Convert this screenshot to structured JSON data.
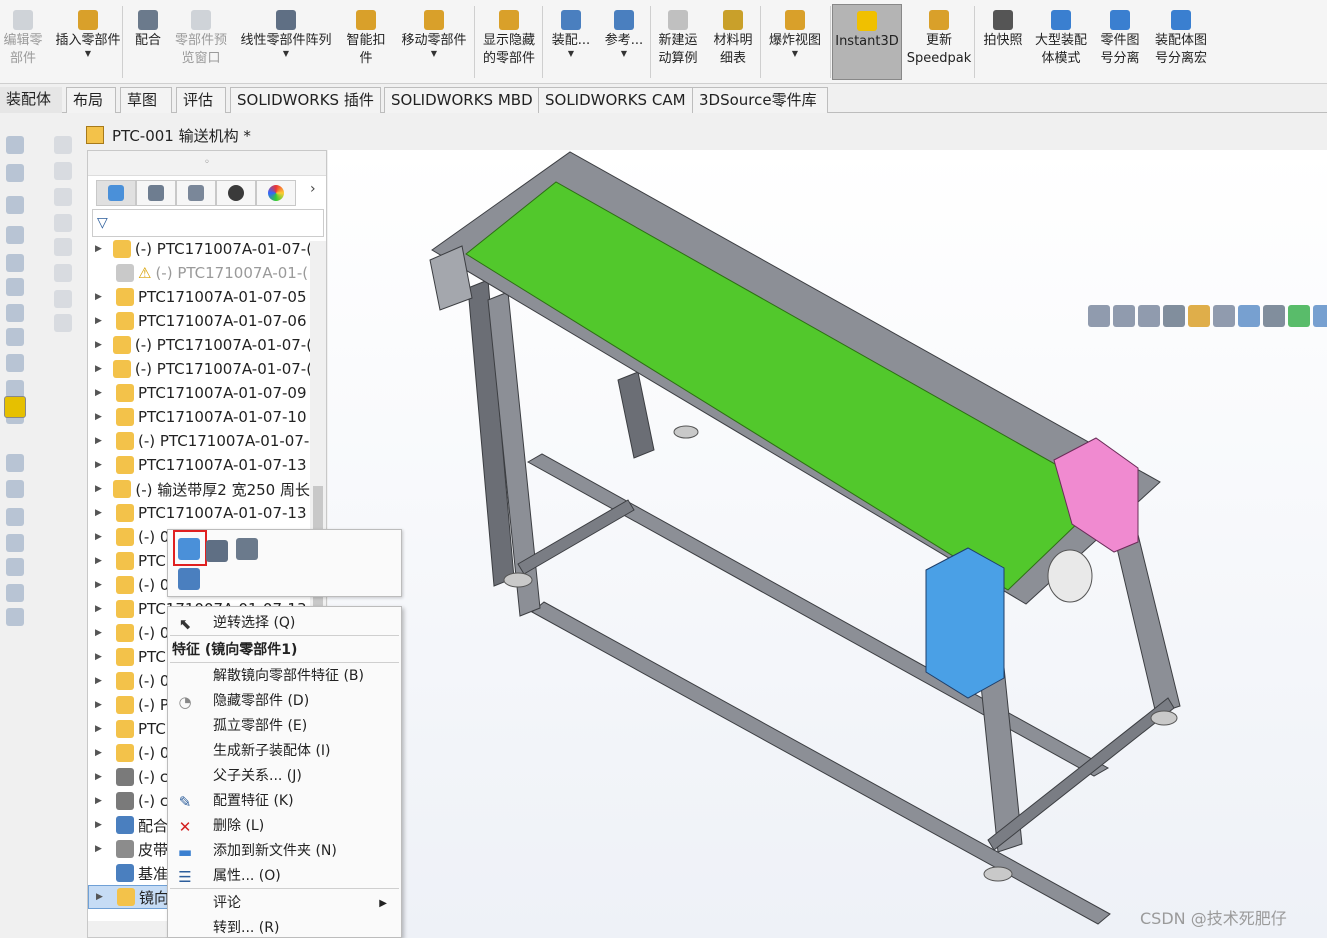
{
  "ribbon": [
    {
      "label": "编辑零\n部件",
      "disabled": true,
      "icon": "edit-component-icon"
    },
    {
      "label": "插入零部件",
      "disabled": false,
      "dropdown": true,
      "icon": "insert-component-icon"
    },
    {
      "label": "配合",
      "disabled": false,
      "icon": "mate-icon"
    },
    {
      "label": "零部件预\n览窗口",
      "disabled": true,
      "icon": "preview-window-icon"
    },
    {
      "label": "线性零部件阵列",
      "disabled": false,
      "dropdown": true,
      "icon": "linear-pattern-icon"
    },
    {
      "label": "智能扣\n件",
      "disabled": false,
      "icon": "smart-fastener-icon"
    },
    {
      "label": "移动零部件",
      "disabled": false,
      "dropdown": true,
      "icon": "move-component-icon"
    },
    {
      "label": "显示隐藏\n的零部件",
      "disabled": false,
      "icon": "show-hidden-icon"
    },
    {
      "label": "装配...",
      "disabled": false,
      "dropdown": true,
      "icon": "assembly-feature-icon"
    },
    {
      "label": "参考...",
      "disabled": false,
      "dropdown": true,
      "icon": "reference-geometry-icon"
    },
    {
      "label": "新建运\n动算例",
      "disabled": false,
      "icon": "motion-study-icon"
    },
    {
      "label": "材料明\n细表",
      "disabled": false,
      "icon": "bom-icon"
    },
    {
      "label": "爆炸视图",
      "disabled": false,
      "dropdown": true,
      "icon": "exploded-view-icon"
    },
    {
      "label": "Instant3D",
      "disabled": false,
      "active": true,
      "icon": "instant3d-icon"
    },
    {
      "label": "更新\nSpeedpak",
      "disabled": false,
      "icon": "speedpak-icon"
    },
    {
      "label": "拍快照",
      "disabled": false,
      "icon": "snapshot-icon"
    },
    {
      "label": "大型装配\n体模式",
      "disabled": false,
      "icon": "large-assembly-icon"
    },
    {
      "label": "零件图\n号分离",
      "disabled": false,
      "icon": "part-number-split-icon"
    },
    {
      "label": "装配体图\n号分离宏",
      "disabled": false,
      "icon": "assembly-number-split-icon"
    }
  ],
  "tabs": [
    "装配体",
    "布局",
    "草图",
    "评估",
    "SOLIDWORKS 插件",
    "SOLIDWORKS MBD",
    "SOLIDWORKS CAM",
    "3DSource零件库"
  ],
  "active_tab": "装配体",
  "document": {
    "title": "PTC-001 输送机构 *"
  },
  "tree": [
    {
      "label": "(-) PTC171007A-01-07-(",
      "type": "component",
      "expand": true
    },
    {
      "label": "(-) PTC171007A-01-(",
      "type": "suppressed",
      "expand": false,
      "dim": true
    },
    {
      "label": "PTC171007A-01-07-05",
      "type": "component",
      "expand": true
    },
    {
      "label": "PTC171007A-01-07-06",
      "type": "component",
      "expand": true
    },
    {
      "label": "(-) PTC171007A-01-07-(",
      "type": "component",
      "expand": true
    },
    {
      "label": "(-) PTC171007A-01-07-(",
      "type": "component",
      "expand": true
    },
    {
      "label": "PTC171007A-01-07-09",
      "type": "component",
      "expand": true
    },
    {
      "label": "PTC171007A-01-07-10",
      "type": "component",
      "expand": true
    },
    {
      "label": "(-) PTC171007A-01-07-",
      "type": "component",
      "expand": true
    },
    {
      "label": "PTC171007A-01-07-13",
      "type": "component",
      "expand": true
    },
    {
      "label": "(-) 输送带厚2 宽250 周长",
      "type": "component",
      "expand": true
    },
    {
      "label": "PTC171007A-01-07-13",
      "type": "component",
      "expand": true
    },
    {
      "label": "(-) 0",
      "type": "component",
      "expand": true
    },
    {
      "label": "PTC",
      "type": "component",
      "expand": true
    },
    {
      "label": "(-) 0",
      "type": "component",
      "expand": true
    },
    {
      "label": "PTC171007A-01-07-13",
      "type": "component",
      "expand": true
    },
    {
      "label": "(-) 0",
      "type": "component",
      "expand": true
    },
    {
      "label": "PTC",
      "type": "component",
      "expand": true
    },
    {
      "label": "(-) 0",
      "type": "component",
      "expand": true
    },
    {
      "label": "(-) P",
      "type": "component",
      "expand": true
    },
    {
      "label": "PTC",
      "type": "component",
      "expand": true
    },
    {
      "label": "(-) 0",
      "type": "component",
      "expand": true
    },
    {
      "label": "(-) ci",
      "type": "screw",
      "expand": true
    },
    {
      "label": "(-) ci",
      "type": "screw",
      "expand": true
    },
    {
      "label": "配合",
      "type": "mates",
      "expand": true
    },
    {
      "label": "皮带",
      "type": "belt",
      "expand": true
    },
    {
      "label": "基准",
      "type": "plane",
      "expand": false
    },
    {
      "label": "镜向",
      "type": "mirror",
      "expand": true,
      "selected": true
    }
  ],
  "context_toolbar": {
    "items": [
      "open-component-icon",
      "rebuild-order-icon",
      "mate-clip-icon",
      "move-triad-icon"
    ]
  },
  "context_menu": {
    "items": [
      {
        "kind": "item",
        "label": "逆转选择 (Q)",
        "icon": "invert-selection-icon"
      },
      {
        "kind": "header",
        "label": "特征 (镜向零部件1)"
      },
      {
        "kind": "item",
        "label": "解散镜向零部件特征 (B)",
        "icon": ""
      },
      {
        "kind": "item",
        "label": "隐藏零部件 (D)",
        "icon": "hide-icon"
      },
      {
        "kind": "item",
        "label": "孤立零部件 (E)",
        "icon": ""
      },
      {
        "kind": "item",
        "label": "生成新子装配体 (I)",
        "icon": ""
      },
      {
        "kind": "item",
        "label": "父子关系... (J)",
        "icon": ""
      },
      {
        "kind": "item",
        "label": "配置特征 (K)",
        "icon": "configure-feature-icon"
      },
      {
        "kind": "item",
        "label": "删除 (L)",
        "icon": "delete-icon"
      },
      {
        "kind": "item",
        "label": "添加到新文件夹 (N)",
        "icon": "folder-icon"
      },
      {
        "kind": "item",
        "label": "属性... (O)",
        "icon": "properties-icon"
      },
      {
        "kind": "item",
        "label": "评论",
        "icon": "",
        "submenu": true
      },
      {
        "kind": "item",
        "label": "转到... (R)",
        "icon": ""
      }
    ]
  },
  "view_toolbar": [
    "zoom-to-fit-icon",
    "zoom-area-icon",
    "previous-view-icon",
    "section-view-icon",
    "dynamic-annotation-icon",
    "view-orientation-icon",
    "display-style-icon",
    "hide-show-icon",
    "edit-appearance-icon",
    "apply-scene-icon",
    "view-settings-icon"
  ],
  "colors": {
    "belt": "#52c82c",
    "drive_box_pink": "#f08ad0",
    "motor_box_blue": "#4aa0e6",
    "frame": "#8c8f96"
  },
  "watermark": "CSDN @技术死肥仔"
}
